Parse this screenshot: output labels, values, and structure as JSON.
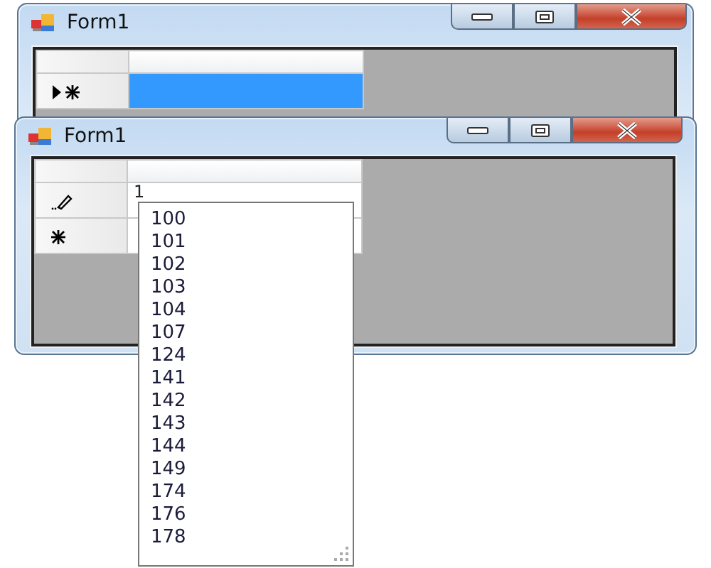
{
  "windows": [
    {
      "title": "Form1",
      "rows": [
        {
          "kind": "current-new",
          "value": "",
          "selected": true
        }
      ]
    },
    {
      "title": "Form1",
      "rows": [
        {
          "kind": "editing",
          "value": "1",
          "selected": false
        },
        {
          "kind": "new",
          "value": "",
          "selected": false
        }
      ]
    }
  ],
  "dropdown": {
    "items": [
      "100",
      "101",
      "102",
      "103",
      "104",
      "107",
      "124",
      "141",
      "142",
      "143",
      "144",
      "149",
      "174",
      "176",
      "178"
    ]
  }
}
